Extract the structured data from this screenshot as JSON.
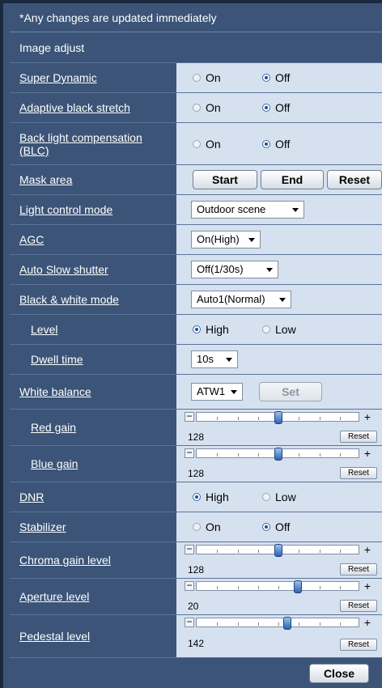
{
  "notice": "*Any changes are updated immediately",
  "section_title": "Image adjust",
  "labels": {
    "super_dynamic": "Super Dynamic",
    "adaptive_black": "Adaptive black stretch",
    "blc": "Back light compensation (BLC)",
    "mask_area": "Mask area",
    "light_control": "Light control mode",
    "agc": "AGC",
    "auto_slow": "Auto Slow shutter",
    "bw_mode": "Black & white mode",
    "level": "Level",
    "dwell": "Dwell time",
    "white_balance": "White balance",
    "red_gain": "Red gain",
    "blue_gain": "Blue gain",
    "dnr": "DNR",
    "stabilizer": "Stabilizer",
    "chroma": "Chroma gain level",
    "aperture": "Aperture level",
    "pedestal": "Pedestal level"
  },
  "radio": {
    "on": "On",
    "off": "Off",
    "high": "High",
    "low": "Low"
  },
  "radio_state": {
    "super_dynamic": "off",
    "adaptive_black": "off",
    "blc": "off",
    "level": "high",
    "dnr": "high",
    "stabilizer": "off"
  },
  "buttons": {
    "start": "Start",
    "end": "End",
    "reset": "Reset",
    "set": "Set",
    "close": "Close",
    "slider_reset": "Reset"
  },
  "selects": {
    "light_control": "Outdoor scene",
    "agc": "On(High)",
    "auto_slow": "Off(1/30s)",
    "bw_mode": "Auto1(Normal)",
    "dwell": "10s",
    "white_balance": "ATW1"
  },
  "sliders": {
    "red_gain": {
      "value": "128",
      "fraction": 0.5
    },
    "blue_gain": {
      "value": "128",
      "fraction": 0.5
    },
    "chroma": {
      "value": "128",
      "fraction": 0.5
    },
    "aperture": {
      "value": "20",
      "fraction": 0.625
    },
    "pedestal": {
      "value": "142",
      "fraction": 0.555
    }
  },
  "slider_symbols": {
    "minus": "−",
    "plus": "+"
  }
}
